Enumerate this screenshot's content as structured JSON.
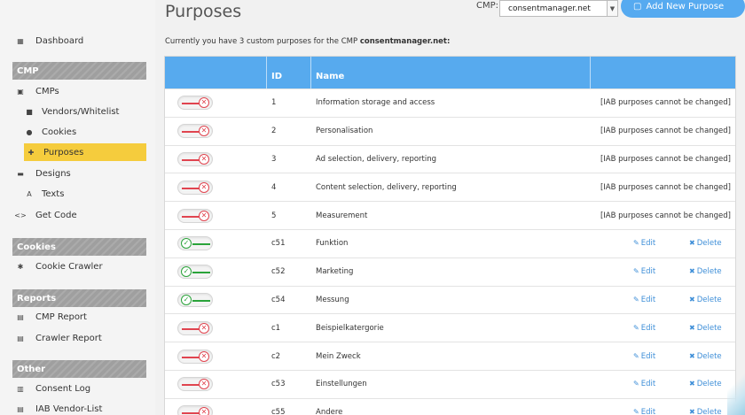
{
  "sidebar": {
    "dashboard": "Dashboard",
    "sections": {
      "cmp": "CMP",
      "cookies": "Cookies",
      "reports": "Reports",
      "other": "Other"
    },
    "items": {
      "cmps": "CMPs",
      "vendors": "Vendors/Whitelist",
      "cookies": "Cookies",
      "purposes": "Purposes",
      "designs": "Designs",
      "texts": "Texts",
      "get_code": "Get Code",
      "cookie_crawler": "Cookie Crawler",
      "cmp_report": "CMP Report",
      "crawler_report": "Crawler Report",
      "consent_log": "Consent Log",
      "iab_vendor_list": "IAB Vendor-List"
    }
  },
  "header": {
    "title": "Purposes",
    "cmp_label": "CMP:",
    "cmp_selected": "consentmanager.net",
    "add_button": "Add New Purpose"
  },
  "intro": {
    "text": "Currently you have 3 custom purposes for the CMP ",
    "cmp_name": "consentmanager.net:"
  },
  "table": {
    "columns": {
      "id": "ID",
      "name": "Name"
    },
    "iab_note": "[IAB purposes cannot be changed]",
    "edit_label": "Edit",
    "delete_label": "Delete",
    "rows": [
      {
        "enabled": false,
        "id": "1",
        "name": "Information storage and access",
        "iab": true
      },
      {
        "enabled": false,
        "id": "2",
        "name": "Personalisation",
        "iab": true
      },
      {
        "enabled": false,
        "id": "3",
        "name": "Ad selection, delivery, reporting",
        "iab": true
      },
      {
        "enabled": false,
        "id": "4",
        "name": "Content selection, delivery, reporting",
        "iab": true
      },
      {
        "enabled": false,
        "id": "5",
        "name": "Measurement",
        "iab": true
      },
      {
        "enabled": true,
        "id": "c51",
        "name": "Funktion",
        "iab": false
      },
      {
        "enabled": true,
        "id": "c52",
        "name": "Marketing",
        "iab": false
      },
      {
        "enabled": true,
        "id": "c54",
        "name": "Messung",
        "iab": false
      },
      {
        "enabled": false,
        "id": "c1",
        "name": "Beispielkatergorie",
        "iab": false
      },
      {
        "enabled": false,
        "id": "c2",
        "name": "Mein Zweck",
        "iab": false
      },
      {
        "enabled": false,
        "id": "c53",
        "name": "Einstellungen",
        "iab": false
      },
      {
        "enabled": false,
        "id": "c55",
        "name": "Andere",
        "iab": false
      }
    ]
  },
  "colors": {
    "accent": "#57aaee",
    "active_nav": "#f5cc3d",
    "toggle_on": "#2aa33a",
    "toggle_off": "#e0444f"
  }
}
